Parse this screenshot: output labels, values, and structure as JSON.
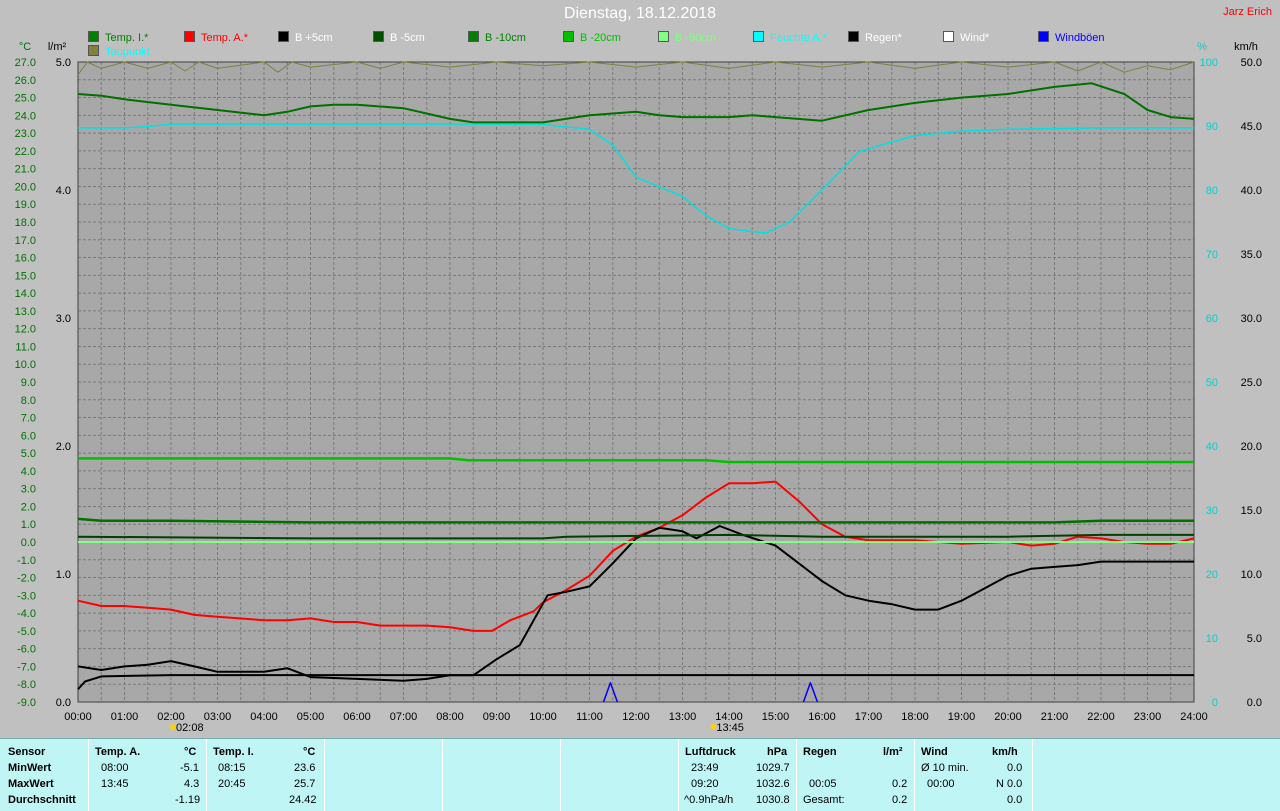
{
  "title": "Dienstag, 18.12.2018",
  "author": "Jarz Erich",
  "legend": [
    {
      "label": "Temp. I.*",
      "color": "#008000"
    },
    {
      "label": "Temp. A.*",
      "color": "#ff0000"
    },
    {
      "label": "B +5cm",
      "color": "#000000"
    },
    {
      "label": "B -5cm",
      "color": "#005000"
    },
    {
      "label": "B -10cm",
      "color": "#008000"
    },
    {
      "label": "B -20cm",
      "color": "#00c000"
    },
    {
      "label": "B -50cm",
      "color": "#80ff80"
    },
    {
      "label": "Feuchte A.*",
      "color": "#00ffff"
    },
    {
      "label": "Regen*",
      "color": "#000000"
    },
    {
      "label": "Wind*",
      "color": "#ffffff"
    },
    {
      "label": "Windböen",
      "color": "#0000ff"
    },
    {
      "label": "Taupunkt",
      "color": "#00ffff"
    },
    {
      "label": "Luftdruck",
      "color": "#808040"
    }
  ],
  "chart_data": {
    "type": "line",
    "title": "Dienstag, 18.12.2018",
    "grid": true,
    "axes": {
      "temp": {
        "unit": "°C",
        "min": -9.0,
        "max": 27.0,
        "ticks": [
          "27.0",
          "26.0",
          "25.0",
          "24.0",
          "23.0",
          "22.0",
          "21.0",
          "20.0",
          "19.0",
          "18.0",
          "17.0",
          "16.0",
          "15.0",
          "14.0",
          "13.0",
          "12.0",
          "11.0",
          "10.0",
          "9.0",
          "8.0",
          "7.0",
          "6.0",
          "5.0",
          "4.0",
          "3.0",
          "2.0",
          "1.0",
          "0.0",
          "-1.0",
          "-2.0",
          "-3.0",
          "-4.0",
          "-5.0",
          "-6.0",
          "-7.0",
          "-8.0",
          "-9.0"
        ]
      },
      "rain": {
        "unit": "l/m²",
        "min": 0,
        "max": 5,
        "ticks": [
          "5.0",
          "4.0",
          "3.0",
          "2.0",
          "1.0",
          "0.0"
        ]
      },
      "humidity": {
        "unit": "%",
        "min": 0,
        "max": 100,
        "ticks": [
          "100",
          "90",
          "80",
          "70",
          "60",
          "50",
          "40",
          "30",
          "20",
          "10",
          "0"
        ]
      },
      "wind": {
        "unit": "km/h",
        "min": 0,
        "max": 50,
        "ticks": [
          "50.0",
          "45.0",
          "40.0",
          "35.0",
          "30.0",
          "25.0",
          "20.0",
          "15.0",
          "10.0",
          "5.0",
          "0.0"
        ]
      }
    },
    "x": {
      "min": 0,
      "max": 24,
      "ticks": [
        "00:00",
        "01:00",
        "02:00",
        "03:00",
        "04:00",
        "05:00",
        "06:00",
        "07:00",
        "08:00",
        "09:00",
        "10:00",
        "11:00",
        "12:00",
        "13:00",
        "14:00",
        "15:00",
        "16:00",
        "17:00",
        "18:00",
        "19:00",
        "20:00",
        "21:00",
        "22:00",
        "23:00",
        "24:00"
      ]
    },
    "markers": [
      {
        "label": "02:08",
        "x": 2.13
      },
      {
        "label": "13:45",
        "x": 13.75
      }
    ],
    "series": [
      {
        "name": "Temp. I.*",
        "axis": "temp",
        "color": "#007000",
        "width": 2,
        "points": [
          [
            0,
            25.2
          ],
          [
            0.5,
            25.1
          ],
          [
            1,
            24.9
          ],
          [
            2,
            24.6
          ],
          [
            3,
            24.3
          ],
          [
            4,
            24.0
          ],
          [
            4.5,
            24.2
          ],
          [
            5,
            24.5
          ],
          [
            5.5,
            24.6
          ],
          [
            6,
            24.6
          ],
          [
            7,
            24.4
          ],
          [
            8,
            23.8
          ],
          [
            8.5,
            23.6
          ],
          [
            9,
            23.6
          ],
          [
            10,
            23.6
          ],
          [
            11,
            24.0
          ],
          [
            12,
            24.2
          ],
          [
            12.5,
            24.0
          ],
          [
            13,
            23.9
          ],
          [
            14,
            23.9
          ],
          [
            14.5,
            24.0
          ],
          [
            15,
            23.9
          ],
          [
            16,
            23.7
          ],
          [
            17,
            24.3
          ],
          [
            18,
            24.7
          ],
          [
            19,
            25.0
          ],
          [
            20,
            25.2
          ],
          [
            21,
            25.6
          ],
          [
            21.8,
            25.8
          ],
          [
            22.5,
            25.2
          ],
          [
            23,
            24.3
          ],
          [
            23.5,
            23.9
          ],
          [
            24,
            23.8
          ]
        ]
      },
      {
        "name": "Feuchte A.*",
        "axis": "humidity",
        "color": "#00e0e0",
        "width": 1.5,
        "points": [
          [
            0,
            89.7
          ],
          [
            1,
            89.7
          ],
          [
            1.5,
            89.9
          ],
          [
            2,
            90.3
          ],
          [
            5,
            90.3
          ],
          [
            10,
            90.3
          ],
          [
            10.3,
            90.0
          ],
          [
            11,
            89.5
          ],
          [
            11.5,
            87.0
          ],
          [
            12,
            82.0
          ],
          [
            13,
            79.0
          ],
          [
            13.5,
            76.0
          ],
          [
            14,
            74.0
          ],
          [
            14.5,
            73.5
          ],
          [
            14.8,
            73.3
          ],
          [
            15,
            74.0
          ],
          [
            15.3,
            75.0
          ],
          [
            16,
            80.0
          ],
          [
            16.8,
            86.0
          ],
          [
            17.5,
            87.5
          ],
          [
            18,
            88.5
          ],
          [
            19,
            89.2
          ],
          [
            20,
            89.5
          ],
          [
            21,
            89.6
          ],
          [
            22,
            89.7
          ],
          [
            23,
            89.7
          ],
          [
            24,
            89.7
          ]
        ]
      },
      {
        "name": "Temp. A.*",
        "axis": "temp",
        "color": "#ff0000",
        "width": 2,
        "points": [
          [
            0,
            -3.3
          ],
          [
            0.5,
            -3.6
          ],
          [
            1,
            -3.6
          ],
          [
            1.5,
            -3.7
          ],
          [
            2,
            -3.8
          ],
          [
            2.5,
            -4.1
          ],
          [
            3,
            -4.2
          ],
          [
            4,
            -4.4
          ],
          [
            4.5,
            -4.4
          ],
          [
            5,
            -4.3
          ],
          [
            5.5,
            -4.5
          ],
          [
            6,
            -4.5
          ],
          [
            6.5,
            -4.7
          ],
          [
            7,
            -4.7
          ],
          [
            7.5,
            -4.7
          ],
          [
            8,
            -4.8
          ],
          [
            8.5,
            -5.0
          ],
          [
            8.9,
            -5.0
          ],
          [
            9.3,
            -4.4
          ],
          [
            9.8,
            -3.9
          ],
          [
            10,
            -3.4
          ],
          [
            10.5,
            -2.7
          ],
          [
            11,
            -1.9
          ],
          [
            11.5,
            -0.5
          ],
          [
            12,
            0.3
          ],
          [
            12.5,
            0.8
          ],
          [
            13,
            1.5
          ],
          [
            13.5,
            2.5
          ],
          [
            14,
            3.3
          ],
          [
            14.5,
            3.3
          ],
          [
            15,
            3.4
          ],
          [
            15.5,
            2.3
          ],
          [
            16,
            1.0
          ],
          [
            16.5,
            0.3
          ],
          [
            17,
            0.1
          ],
          [
            17.5,
            0.1
          ],
          [
            18,
            0.1
          ],
          [
            18.5,
            0.0
          ],
          [
            19,
            -0.1
          ],
          [
            20,
            0.0
          ],
          [
            20.5,
            -0.2
          ],
          [
            21,
            -0.1
          ],
          [
            21.5,
            0.3
          ],
          [
            22,
            0.2
          ],
          [
            22.5,
            0.0
          ],
          [
            23,
            -0.1
          ],
          [
            23.5,
            -0.1
          ],
          [
            24,
            0.2
          ]
        ]
      },
      {
        "name": "B +5cm",
        "axis": "temp",
        "color": "#000000",
        "width": 2,
        "points": [
          [
            0,
            -7.0
          ],
          [
            0.5,
            -7.2
          ],
          [
            1,
            -7.0
          ],
          [
            1.5,
            -6.9
          ],
          [
            2,
            -6.7
          ],
          [
            2.5,
            -7.0
          ],
          [
            3,
            -7.3
          ],
          [
            4,
            -7.3
          ],
          [
            4.5,
            -7.1
          ],
          [
            5,
            -7.6
          ],
          [
            6,
            -7.7
          ],
          [
            7,
            -7.8
          ],
          [
            7.5,
            -7.7
          ],
          [
            8,
            -7.5
          ],
          [
            8.5,
            -7.5
          ],
          [
            9,
            -6.6
          ],
          [
            9.5,
            -5.8
          ],
          [
            9.8,
            -4.4
          ],
          [
            10.1,
            -3.0
          ],
          [
            10.5,
            -2.8
          ],
          [
            11,
            -2.5
          ],
          [
            11.5,
            -1.2
          ],
          [
            12,
            0.2
          ],
          [
            12.5,
            0.8
          ],
          [
            13,
            0.6
          ],
          [
            13.3,
            0.2
          ],
          [
            13.8,
            0.9
          ],
          [
            14.3,
            0.4
          ],
          [
            15,
            -0.2
          ],
          [
            15.5,
            -1.2
          ],
          [
            16,
            -2.2
          ],
          [
            16.5,
            -3.0
          ],
          [
            17,
            -3.3
          ],
          [
            17.5,
            -3.5
          ],
          [
            18,
            -3.8
          ],
          [
            18.5,
            -3.8
          ],
          [
            19,
            -3.3
          ],
          [
            19.5,
            -2.6
          ],
          [
            20,
            -1.9
          ],
          [
            20.5,
            -1.5
          ],
          [
            21,
            -1.4
          ],
          [
            21.5,
            -1.3
          ],
          [
            22,
            -1.1
          ],
          [
            23,
            -1.1
          ],
          [
            24,
            -1.1
          ]
        ]
      },
      {
        "name": "B -5cm",
        "axis": "temp",
        "color": "#004000",
        "width": 2,
        "points": [
          [
            0,
            0.3
          ],
          [
            5,
            0.2
          ],
          [
            10,
            0.2
          ],
          [
            10.5,
            0.3
          ],
          [
            14,
            0.4
          ],
          [
            16,
            0.3
          ],
          [
            18,
            0.3
          ],
          [
            20,
            0.3
          ],
          [
            22,
            0.4
          ],
          [
            24,
            0.4
          ]
        ]
      },
      {
        "name": "B -10cm",
        "axis": "temp",
        "color": "#007000",
        "width": 2.5,
        "points": [
          [
            0,
            1.3
          ],
          [
            0.5,
            1.2
          ],
          [
            2,
            1.2
          ],
          [
            5,
            1.1
          ],
          [
            8,
            1.1
          ],
          [
            10,
            1.1
          ],
          [
            14,
            1.1
          ],
          [
            18,
            1.1
          ],
          [
            21,
            1.1
          ],
          [
            22,
            1.2
          ],
          [
            24,
            1.2
          ]
        ]
      },
      {
        "name": "B -20cm",
        "axis": "temp",
        "color": "#00c000",
        "width": 2.5,
        "points": [
          [
            0,
            4.7
          ],
          [
            8,
            4.7
          ],
          [
            8.4,
            4.6
          ],
          [
            9,
            4.6
          ],
          [
            13.5,
            4.6
          ],
          [
            14,
            4.5
          ],
          [
            24,
            4.5
          ]
        ]
      },
      {
        "name": "B -50cm",
        "axis": "temp",
        "color": "#80ff80",
        "width": 2,
        "points": [
          [
            0,
            0.0
          ],
          [
            24,
            0.0
          ]
        ]
      },
      {
        "name": "Luftdruck",
        "axis": "rain",
        "color": "#808040",
        "width": 1,
        "points": [
          [
            0,
            4.9
          ],
          [
            0.2,
            5.0
          ],
          [
            0.5,
            4.95
          ],
          [
            1,
            5.0
          ],
          [
            1.5,
            4.95
          ],
          [
            2,
            5.0
          ],
          [
            2.3,
            4.93
          ],
          [
            2.6,
            5.0
          ],
          [
            3,
            4.95
          ],
          [
            4,
            5.0
          ],
          [
            4.3,
            4.92
          ],
          [
            4.6,
            5.0
          ],
          [
            5,
            4.96
          ],
          [
            6,
            5.0
          ],
          [
            6.5,
            4.95
          ],
          [
            7,
            5.0
          ],
          [
            8,
            4.96
          ],
          [
            9,
            5.0
          ],
          [
            10,
            4.97
          ],
          [
            11,
            5.0
          ],
          [
            12,
            4.96
          ],
          [
            13,
            5.0
          ],
          [
            14,
            4.95
          ],
          [
            15,
            5.0
          ],
          [
            16,
            4.96
          ],
          [
            17,
            5.0
          ],
          [
            18,
            4.95
          ],
          [
            19,
            5.0
          ],
          [
            20,
            4.96
          ],
          [
            21,
            5.0
          ],
          [
            21.5,
            4.93
          ],
          [
            22,
            5.0
          ],
          [
            22.5,
            4.92
          ],
          [
            23,
            4.97
          ],
          [
            23.5,
            4.94
          ],
          [
            24,
            5.0
          ]
        ]
      },
      {
        "name": "Regen*",
        "axis": "rain",
        "color": "#000000",
        "width": 2,
        "points": [
          [
            0,
            0.1
          ],
          [
            0.15,
            0.16
          ],
          [
            0.5,
            0.2
          ],
          [
            2,
            0.21
          ],
          [
            24,
            0.21
          ]
        ]
      },
      {
        "name": "Windböen",
        "axis": "wind",
        "color": "#0000ff",
        "width": 1.5,
        "points": [
          [
            11.3,
            0
          ],
          [
            11.45,
            1.5
          ],
          [
            11.6,
            0
          ]
        ],
        "points2": [
          [
            15.6,
            0
          ],
          [
            15.75,
            1.5
          ],
          [
            15.9,
            0
          ]
        ]
      }
    ]
  },
  "stats": {
    "sensor": {
      "header": "Sensor",
      "rows": [
        "MinWert",
        "MaxWert",
        "Durchschnitt"
      ]
    },
    "temp_a": {
      "header": "Temp. A.",
      "unit": "°C",
      "min_time": "08:00",
      "min_val": "-5.1",
      "max_time": "13:45",
      "max_val": "4.3",
      "avg": "-1.19"
    },
    "temp_i": {
      "header": "Temp. I.",
      "unit": "°C",
      "min_time": "08:15",
      "min_val": "23.6",
      "max_time": "20:45",
      "max_val": "25.7",
      "avg": "24.42"
    },
    "pressure": {
      "header": "Luftdruck",
      "unit": "hPa",
      "min_time": "23:49",
      "min_val": "1029.7",
      "max_time": "09:20",
      "max_val": "1032.6",
      "trend": "^0.9hPa/h",
      "avg": "1030.8"
    },
    "rain": {
      "header": "Regen",
      "unit": "l/m²",
      "max_time": "00:05",
      "max_val": "0.2",
      "total_label": "Gesamt:",
      "total": "0.2"
    },
    "wind": {
      "header": "Wind",
      "unit": "km/h",
      "min_label": "Ø 10 min.",
      "min_val": "0.0",
      "max_time": "00:00",
      "max_val": "N 0.0",
      "avg": "0.0"
    }
  }
}
